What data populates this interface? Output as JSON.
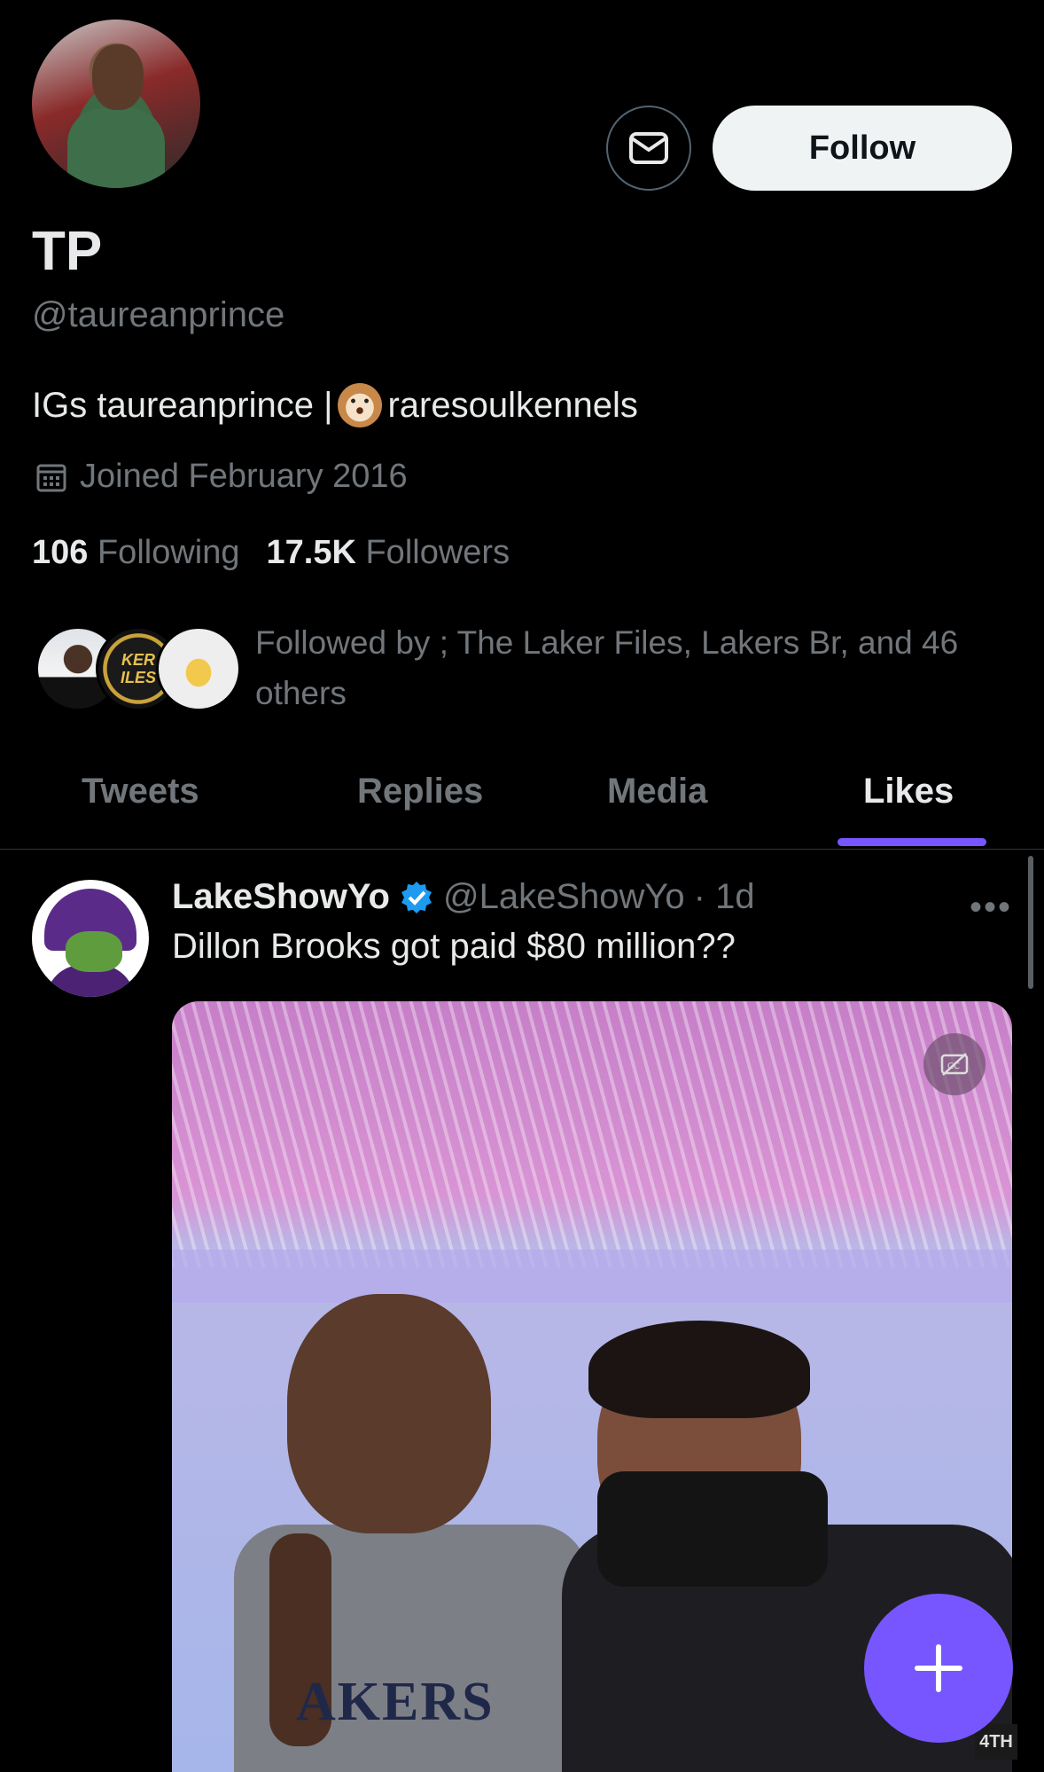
{
  "profile": {
    "name": "TP",
    "handle": "@taureanprince",
    "bio_prefix": "IGs taureanprince |",
    "bio_suffix": "raresoulkennels",
    "joined": "Joined February 2016",
    "following_count": "106",
    "following_label": "Following",
    "followers_count": "17.5K",
    "followers_label": "Followers",
    "followed_by": "Followed by ; The Laker Files, Lakers Br, and 46 others",
    "follow_button": "Follow"
  },
  "tabs": [
    {
      "label": "Tweets"
    },
    {
      "label": "Replies"
    },
    {
      "label": "Media"
    },
    {
      "label": "Likes"
    }
  ],
  "active_tab": "Likes",
  "tweet": {
    "author_name": "LakeShowYo",
    "author_handle": "@LakeShowYo",
    "time": "· 1d",
    "text": "Dillon Brooks got paid $80 million??",
    "more": "•••",
    "media_overlay_text": "AKERS",
    "corner_badge": "4TH"
  },
  "fan_badge_text": "KER\nILES",
  "colors": {
    "accent": "#7856ff",
    "verified": "#1d9bf0",
    "background": "#000000",
    "muted_text": "#71767b"
  },
  "icons": {
    "message": "mail-icon",
    "calendar": "calendar-icon",
    "verified": "verified-badge-icon",
    "compose": "plus-icon",
    "captions": "captions-off-icon"
  }
}
